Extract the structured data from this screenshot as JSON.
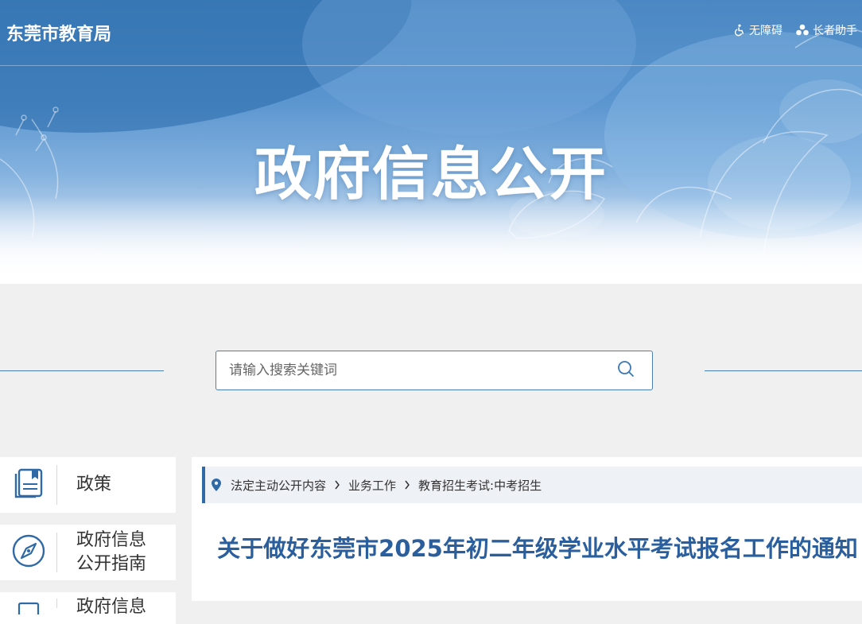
{
  "header": {
    "site_name": "东莞市教育局",
    "tools": [
      {
        "label": "无障碍",
        "icon": "wheelchair-icon"
      },
      {
        "label": "长者助手",
        "icon": "elder-assist-icon"
      }
    ]
  },
  "banner": {
    "title": "政府信息公开"
  },
  "search": {
    "placeholder": "请输入搜索关键词",
    "icon": "search-icon"
  },
  "sidebar": {
    "items": [
      {
        "label": "政策",
        "icon": "book-icon"
      },
      {
        "label": "政府信息\n公开指南",
        "icon": "compass-icon"
      },
      {
        "label": "政府信息",
        "icon": "document-icon"
      }
    ]
  },
  "breadcrumb": {
    "icon": "location-pin-icon",
    "items": [
      "法定主动公开内容",
      "业务工作",
      "教育招生考试:中考招生"
    ]
  },
  "article": {
    "title": "关于做好东莞市2025年初二年级学业水平考试报名工作的通知"
  },
  "colors": {
    "accent": "#2f6aa6",
    "title_blue": "#2a5e9c",
    "page_bg": "#f0f0f0"
  }
}
